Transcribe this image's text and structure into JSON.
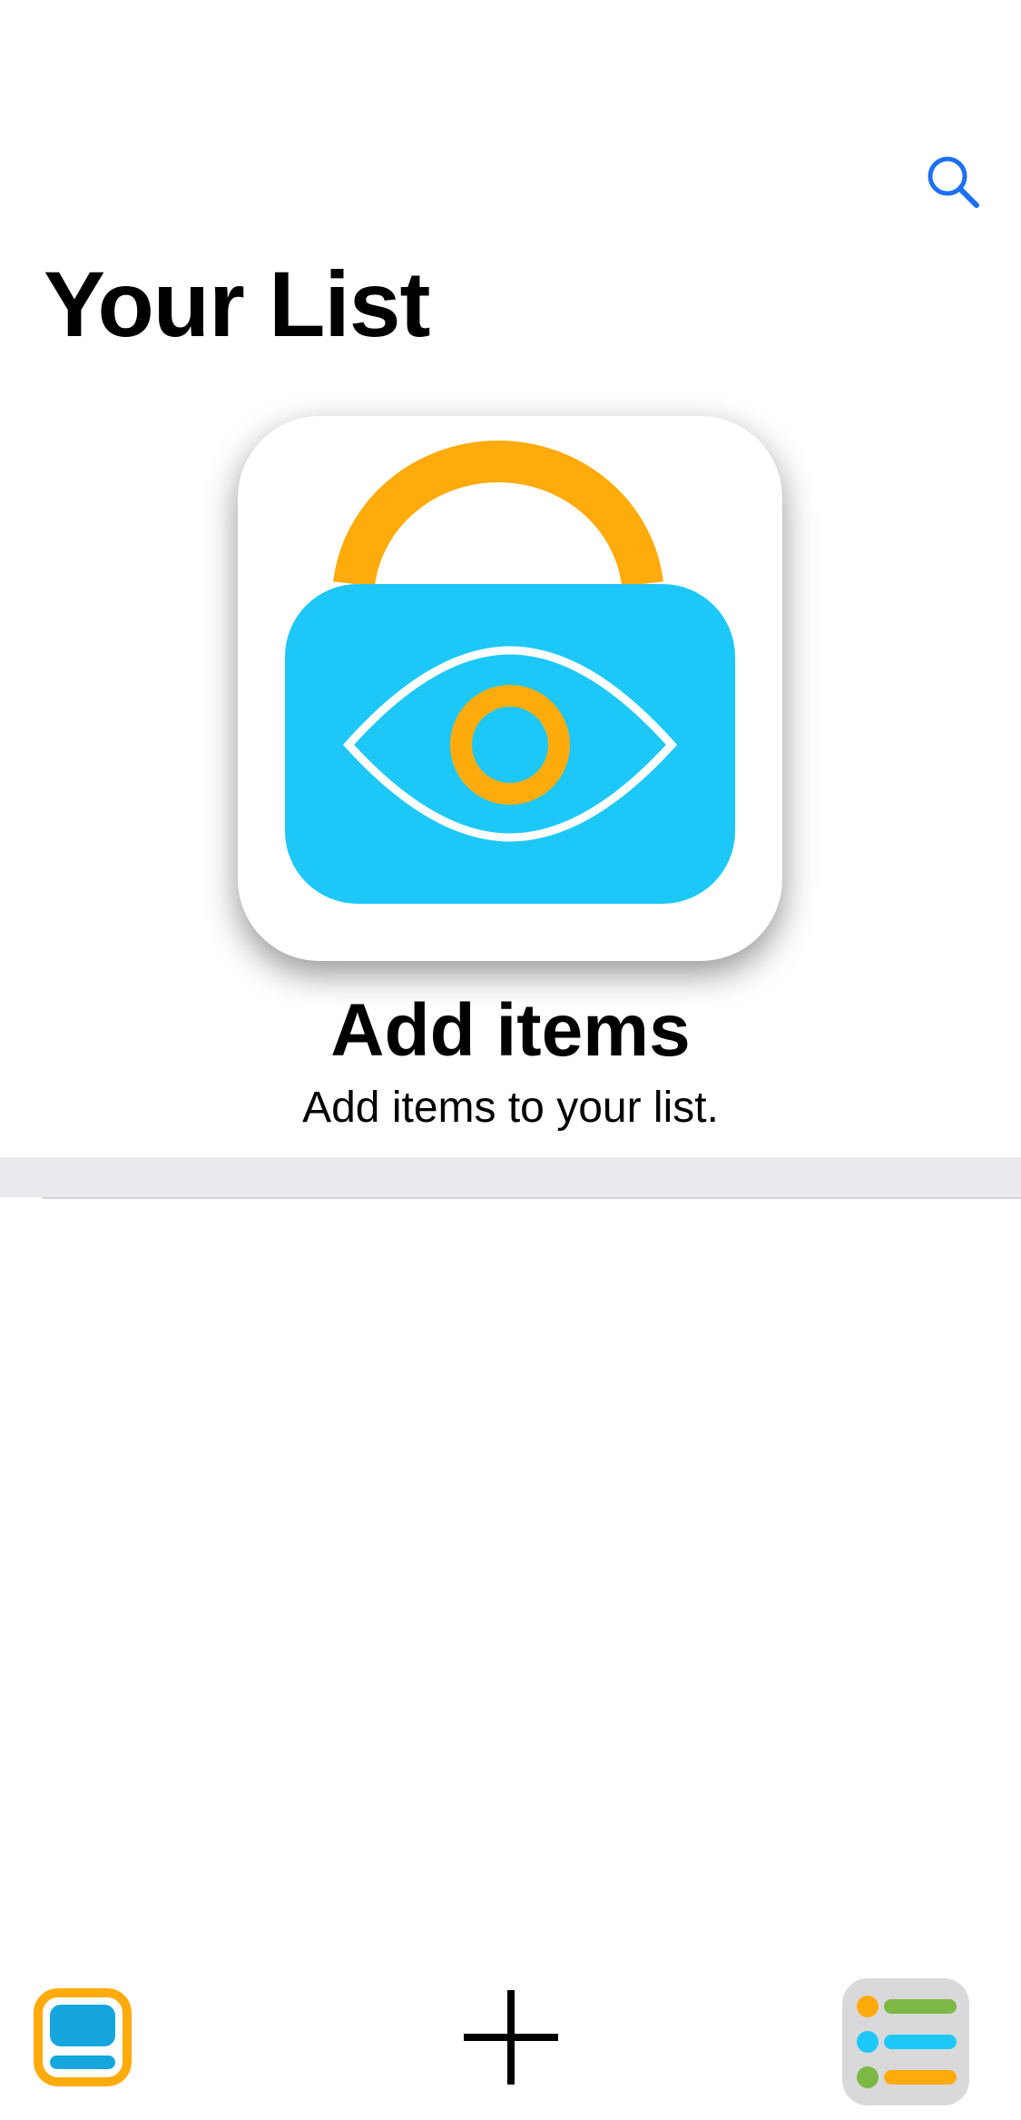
{
  "header": {
    "title": "Your List",
    "search_icon": "search-icon"
  },
  "empty_state": {
    "icon": "locked-bag-eye-icon",
    "title": "Add items",
    "subtitle": "Add items to your list."
  },
  "tab_bar": {
    "items": [
      {
        "name": "home-tab",
        "icon": "tray-icon"
      },
      {
        "name": "add-tab",
        "icon": "plus-icon"
      },
      {
        "name": "lists-tab",
        "icon": "list-icon"
      }
    ]
  },
  "colors": {
    "accent_blue": "#1e6ff2",
    "bag_blue": "#1dc8f9",
    "handle_orange": "#ffab0c",
    "list_green": "#7bb844",
    "divider_gray": "#eaeaef",
    "tab_home_blue": "#15a6dd"
  }
}
